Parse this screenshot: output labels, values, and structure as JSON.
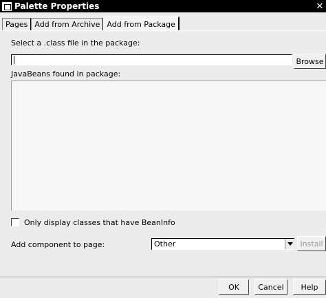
{
  "window": {
    "title": "Palette Properties"
  },
  "tabs": [
    {
      "label": "Pages"
    },
    {
      "label": "Add from Archive"
    },
    {
      "label": "Add from Package",
      "active": true
    }
  ],
  "class_file": {
    "label": "Select a .class file in the package:",
    "value": "",
    "browse_label": "Browse"
  },
  "beans": {
    "label": "JavaBeans found in package:",
    "items": []
  },
  "beaninfo_option": {
    "label": "Only display classes that have BeanInfo",
    "checked": false
  },
  "add_component": {
    "label": "Add component to page:",
    "selected": "Other",
    "install_label": "Install"
  },
  "footer": {
    "ok_label": "OK",
    "cancel_label": "Cancel",
    "help_label": "Help"
  }
}
